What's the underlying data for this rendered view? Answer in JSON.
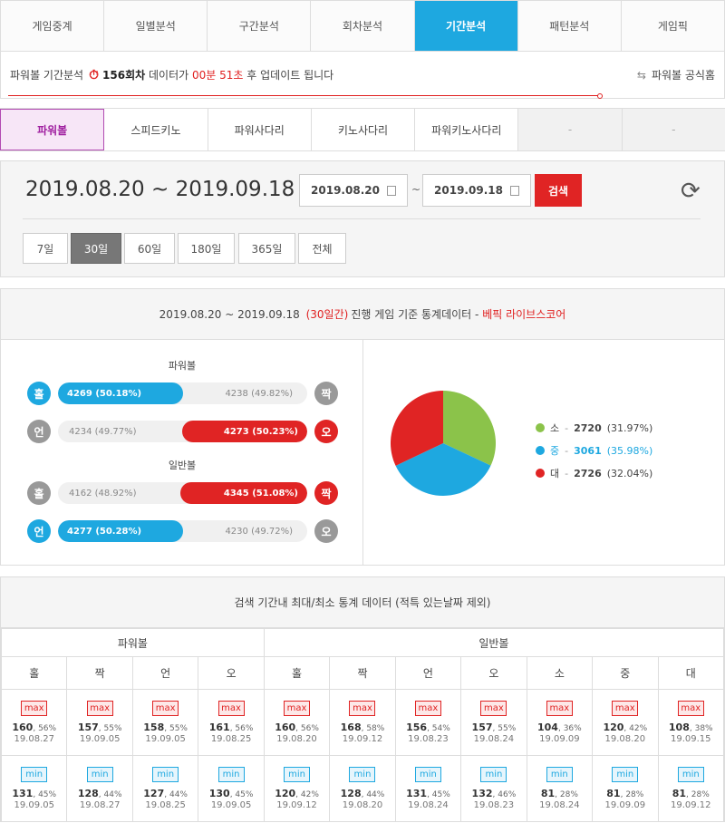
{
  "tabs": [
    "게임중계",
    "일별분석",
    "구간분석",
    "회차분석",
    "기간분석",
    "패턴분석",
    "게임픽"
  ],
  "notice": {
    "prefix": "파워볼 기간분석",
    "round": "156회차",
    "mid": "데이터가",
    "time": "00분 51초",
    "suffix": "후 업데이트 됩니다",
    "home": "파워볼 공식홈"
  },
  "subtabs": [
    "파워볼",
    "스피드키노",
    "파워사다리",
    "키노사다리",
    "파워키노사다리",
    "-",
    "-"
  ],
  "period": {
    "title": "2019.08.20 ~ 2019.09.18",
    "start": "2019.08.20",
    "end": "2019.09.18",
    "tilde": "~",
    "search": "검색",
    "buttons": [
      "7일",
      "30일",
      "60일",
      "180일",
      "365일",
      "전체"
    ]
  },
  "stats": {
    "range": "2019.08.20 ~ 2019.09.18",
    "days": "(30일간)",
    "desc": "진행 게임 기준 통계데이터 -",
    "brand": "베픽 라이브스코어",
    "powerball_caption": "파워볼",
    "normal_caption": "일반볼",
    "bars": [
      {
        "left": "홀",
        "right": "짝",
        "left_label": "4269 (50.18%)",
        "right_label": "4238 (49.82%)",
        "left_pct": 50.18,
        "winner": "left"
      },
      {
        "left": "언",
        "right": "오",
        "left_label": "4234 (49.77%)",
        "right_label": "4273 (50.23%)",
        "left_pct": 49.77,
        "winner": "right"
      },
      {
        "left": "홀",
        "right": "짝",
        "left_label": "4162 (48.92%)",
        "right_label": "4345 (51.08%)",
        "left_pct": 48.92,
        "winner": "right"
      },
      {
        "left": "언",
        "right": "오",
        "left_label": "4277 (50.28%)",
        "right_label": "4230 (49.72%)",
        "left_pct": 50.28,
        "winner": "left"
      }
    ],
    "pie": [
      {
        "name": "소",
        "count": "2720",
        "pct": "(31.97%)",
        "value": 31.97,
        "color": "#8bc34a"
      },
      {
        "name": "중",
        "count": "3061",
        "pct": "(35.98%)",
        "value": 35.98,
        "color": "#1ea8e0"
      },
      {
        "name": "대",
        "count": "2726",
        "pct": "(32.04%)",
        "value": 32.04,
        "color": "#e02424"
      }
    ]
  },
  "maxmin": {
    "title": "검색 기간내 최대/최소 통계 데이터 (적특 있는날짜 제외)",
    "group1": "파워볼",
    "group2": "일반볼",
    "cols": [
      "홀",
      "짝",
      "언",
      "오",
      "홀",
      "짝",
      "언",
      "오",
      "소",
      "중",
      "대"
    ],
    "max_label": "max",
    "min_label": "min",
    "max": [
      [
        "160",
        ", 56%",
        "19.08.27"
      ],
      [
        "157",
        ", 55%",
        "19.09.05"
      ],
      [
        "158",
        ", 55%",
        "19.09.05"
      ],
      [
        "161",
        ", 56%",
        "19.08.25"
      ],
      [
        "160",
        ", 56%",
        "19.08.20"
      ],
      [
        "168",
        ", 58%",
        "19.09.12"
      ],
      [
        "156",
        ", 54%",
        "19.08.23"
      ],
      [
        "157",
        ", 55%",
        "19.08.24"
      ],
      [
        "104",
        ", 36%",
        "19.09.09"
      ],
      [
        "120",
        ", 42%",
        "19.08.20"
      ],
      [
        "108",
        ", 38%",
        "19.09.15"
      ]
    ],
    "min": [
      [
        "131",
        ", 45%",
        "19.09.05"
      ],
      [
        "128",
        ", 44%",
        "19.08.27"
      ],
      [
        "127",
        ", 44%",
        "19.08.25"
      ],
      [
        "130",
        ", 45%",
        "19.09.05"
      ],
      [
        "120",
        ", 42%",
        "19.09.12"
      ],
      [
        "128",
        ", 44%",
        "19.08.20"
      ],
      [
        "131",
        ", 45%",
        "19.08.24"
      ],
      [
        "132",
        ", 46%",
        "19.08.23"
      ],
      [
        "81",
        ", 28%",
        "19.08.24"
      ],
      [
        "81",
        ", 28%",
        "19.09.09"
      ],
      [
        "81",
        ", 28%",
        "19.09.12"
      ]
    ]
  }
}
